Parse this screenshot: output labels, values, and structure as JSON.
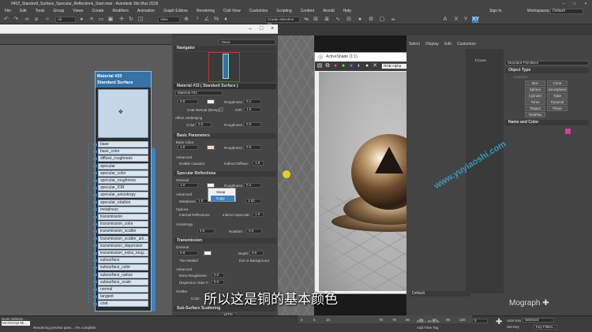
{
  "window": {
    "title": "0402_Standard_Surface_Specular_Reflections_Start.max - Autodesk 3ds Max 2018"
  },
  "menu": {
    "items": [
      "File",
      "Edit",
      "Tools",
      "Group",
      "Views",
      "Create",
      "Modifiers",
      "Animation",
      "Graph Editors",
      "Rendering",
      "Civil View",
      "Customize",
      "Scripting",
      "Content",
      "Arnold",
      "Help"
    ],
    "sign_in": "Sign In",
    "workspaces_label": "Workspaces:",
    "workspace_value": "Default"
  },
  "toolbar": {
    "filter_value": "All",
    "view_value": "View",
    "selection_set": "Create Selection Se"
  },
  "slate": {
    "view_tab": "View1",
    "navigator_label": "Navigator"
  },
  "node": {
    "title": "Material #33",
    "subtitle": "Standard Surface",
    "slots": [
      "base",
      "base_color",
      "diffuse_roughness",
      "specular",
      "specular_color",
      "specular_roughness",
      "specular_IOR",
      "specular_anisotropy",
      "specular_rotation",
      "metalness",
      "transmission",
      "transmission_color",
      "transmission_scatter",
      "transmission_scatter_ani...",
      "transmission_dispersion",
      "transmission_extra_roug...",
      "subsurface",
      "subsurface_color",
      "subsurface_radius",
      "subsurface_scale",
      "normal",
      "tangent",
      "coat"
    ]
  },
  "params": {
    "header": "Material #33  ( Standard Surface )",
    "material_name": "Material #33",
    "roughness_label": "Roughness:",
    "coat_normal": "Coat Normal (Bump):",
    "ior_label": "IOR:",
    "top_value": "0.0",
    "top_roughness": "0.1",
    "top_ior": "1.5",
    "affect_underlying": "Affect Underlying",
    "color_label": "Color:",
    "top_color_value": "0.0",
    "top_rough2": "0.0",
    "basic_params": "Basic Parameters",
    "base_color": "Base Color",
    "base_value": "1.0",
    "base_roughness": "0.0",
    "advanced": "Advanced",
    "enable_caustics": "Enable Caustics",
    "indirect_diffuse": "Indirect Diffuse:",
    "indirect_diffuse_value": "1.0",
    "specular_reflections": "Specular Reflections",
    "general": "General",
    "spec_value": "1.0",
    "spec_roughness": "0.2",
    "metalness_label": "Metalness:",
    "metalness_value": "1.0",
    "ior2_value": "1.52",
    "options": "Options",
    "internal_reflections": "Internal Reflections",
    "indirect_specular": "Indirect Specular:",
    "indirect_specular_value": "1.0",
    "anisotropy": "Anisotropy",
    "aniso_value": "0.0",
    "rotation_label": "Rotation:",
    "rotation_value": "0.0",
    "transmission": "Transmission",
    "trans_value": "0.0",
    "depth_label": "Depth:",
    "depth_value": "0.0",
    "thin_walled": "Thin-Walled",
    "exit_to_background": "Exit to Background",
    "extra_roughness": "Extra Roughness:",
    "extra_roughness_value": "0.0",
    "dispersion_abbe": "Dispersion Abbe #:",
    "dispersion_value": "0.0",
    "scatter": "Scatter",
    "scatter_color_label": "Color:",
    "sub_surface": "Sub-Surface Scattering",
    "zoom": "127%"
  },
  "popup": {
    "items": [
      "Swap",
      "Copy"
    ]
  },
  "activeshade": {
    "title": "ActiveShade (1:1)",
    "channel": "RGB Alpha",
    "mode": "RGBA"
  },
  "command_panel": {
    "tabs": [
      "Select",
      "Display",
      "Edit",
      "Customize"
    ],
    "category": "Standard Primitives",
    "autogrid": "AutoGrid",
    "object_type": "Object Type",
    "buttons": [
      "Box",
      "Cone",
      "Sphere",
      "GeoSphere",
      "Cylinder",
      "Tube",
      "Torus",
      "Pyramid",
      "Teapot",
      "Plane",
      "TextPlus"
    ],
    "name_and_color": "Name and Color",
    "frozen": "Frozen"
  },
  "viewport": {
    "layer_default": "Default"
  },
  "subtitle": "所以这是铜的基本颜色",
  "watermark": "www.yuyiaoshi.com",
  "brand": "Mograph",
  "status": {
    "maxscript": "MAXScript Mi...",
    "selected": "None Selecte...",
    "rendering": "Rendering preview pass... 0% complete",
    "grid": "Grid = 10.0cm",
    "add_time_tag": "Add Time Tag",
    "autokey": "Auto Key",
    "setkey": "Set Key",
    "selected_drop": "Selected",
    "key_filters": "Key Filters...",
    "frame": "0",
    "timeline_ticks": [
      "70",
      "75",
      "80",
      "85",
      "90",
      "95",
      "100"
    ],
    "ticks_left": [
      "0",
      "5",
      "10"
    ]
  },
  "colors": {
    "node_border": "#90b9dc",
    "node_header": "#3572a5",
    "accent_blue": "#3b84c4",
    "watermark": "#37a0c8"
  }
}
